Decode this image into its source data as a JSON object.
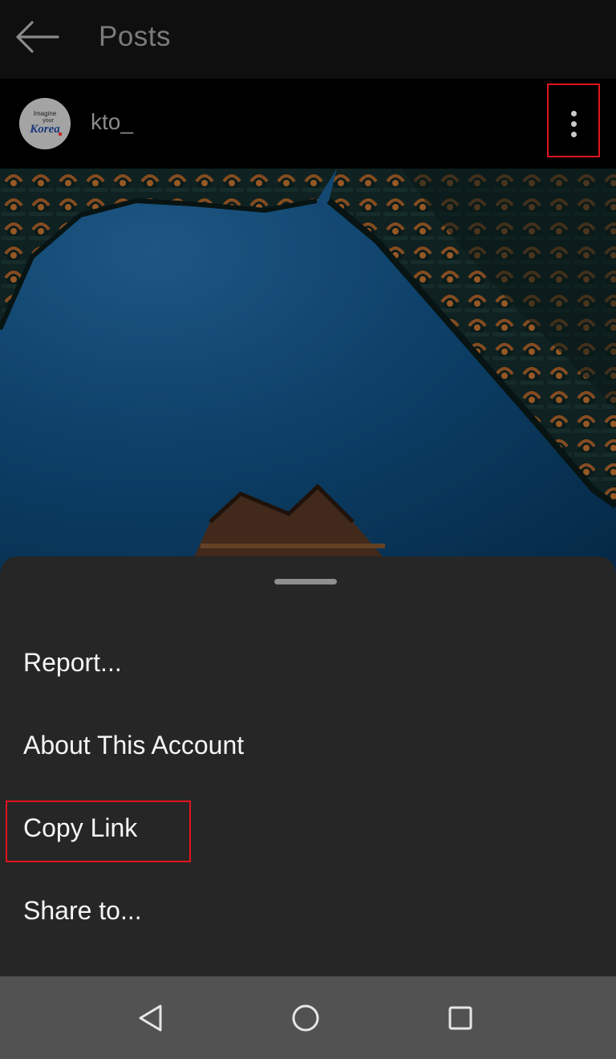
{
  "topbar": {
    "title": "Posts",
    "back_icon": "arrow-left-icon"
  },
  "post": {
    "username": "kto_",
    "avatar_logo": {
      "line1": "Imagine",
      "line2": "your",
      "line3": "Korea"
    },
    "more_icon": "vertical-ellipsis-icon"
  },
  "sheet": {
    "items": [
      {
        "label": "Report..."
      },
      {
        "label": "About This Account"
      },
      {
        "label": "Copy Link"
      },
      {
        "label": "Share to..."
      }
    ]
  },
  "navbar": {
    "back_icon": "nav-back-triangle-icon",
    "home_icon": "nav-home-circle-icon",
    "recents_icon": "nav-recents-square-icon"
  },
  "colors": {
    "highlight": "#e0141e",
    "sheet_bg": "#262626",
    "sky": "#0c4a78"
  }
}
